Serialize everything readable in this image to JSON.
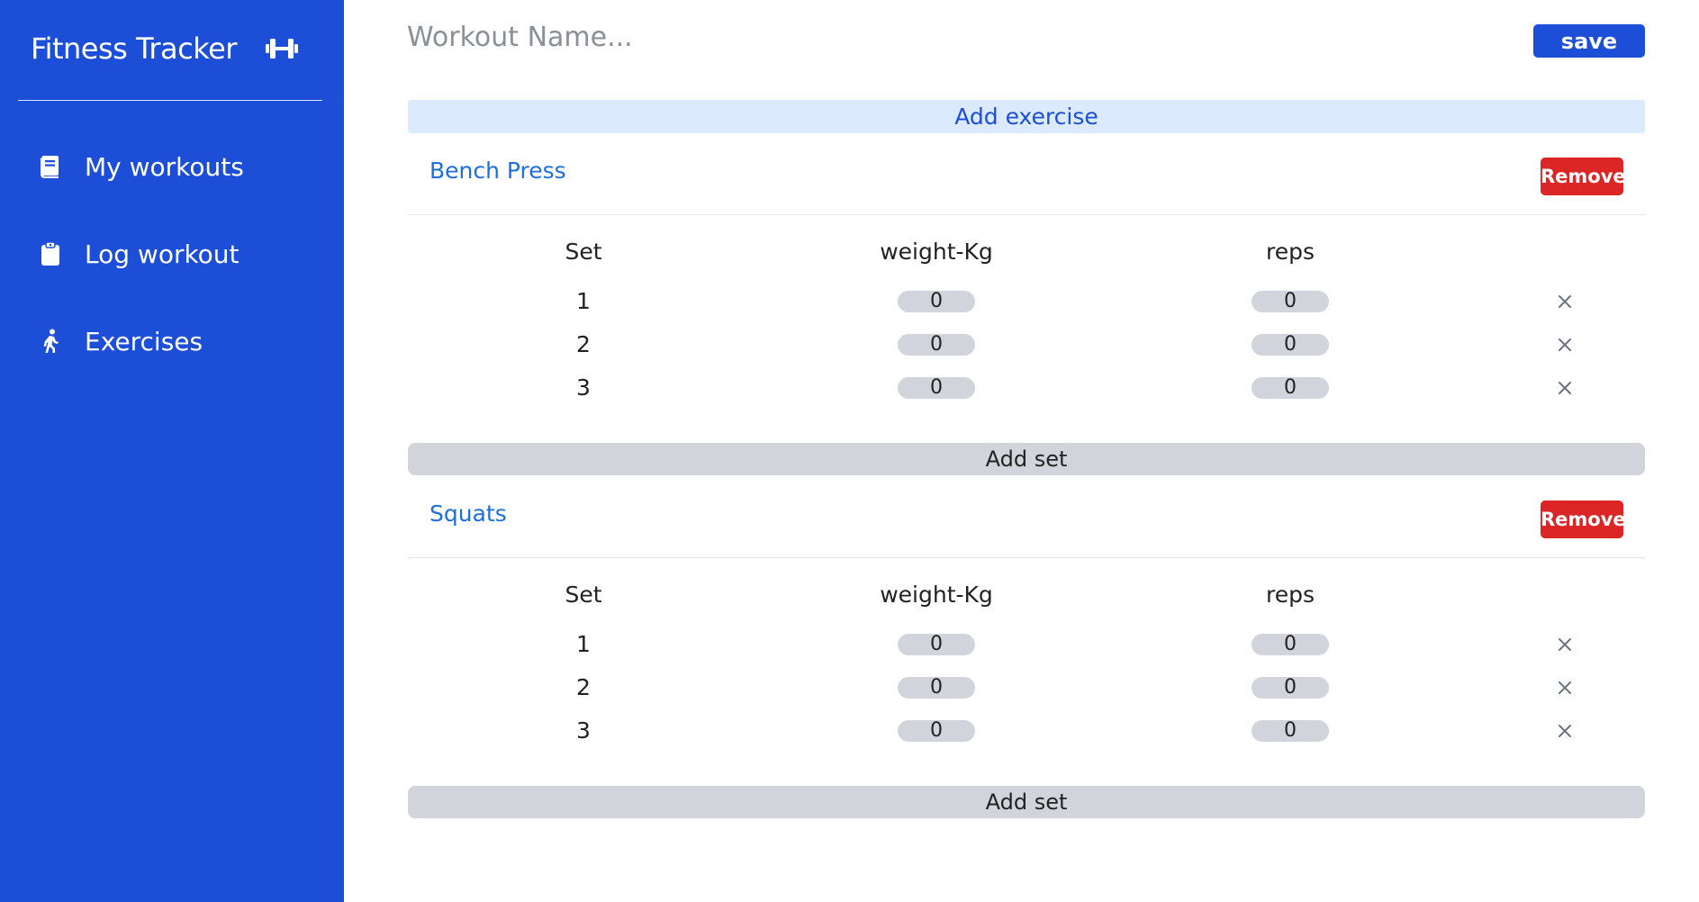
{
  "sidebar": {
    "brand_title": "Fitness Tracker",
    "brand_icon": "dumbbell-icon",
    "items": [
      {
        "label": "My workouts",
        "icon": "book-icon"
      },
      {
        "label": "Log workout",
        "icon": "clipboard-icon"
      },
      {
        "label": "Exercises",
        "icon": "walking-icon"
      }
    ],
    "accent": "#1d4ed8"
  },
  "header": {
    "workout_name_placeholder": "Workout Name...",
    "workout_name_value": "",
    "save_label": "save"
  },
  "add_exercise_label": "Add exercise",
  "exercises": [
    {
      "name": "Bench Press",
      "remove_label": "Remove",
      "columns": [
        "Set",
        "weight-Kg",
        "reps"
      ],
      "sets": [
        {
          "set": "1",
          "weight": "0",
          "reps": "0"
        },
        {
          "set": "2",
          "weight": "0",
          "reps": "0"
        },
        {
          "set": "3",
          "weight": "0",
          "reps": "0"
        }
      ],
      "add_set_label": "Add set"
    },
    {
      "name": "Squats",
      "remove_label": "Remove",
      "columns": [
        "Set",
        "weight-Kg",
        "reps"
      ],
      "sets": [
        {
          "set": "1",
          "weight": "0",
          "reps": "0"
        },
        {
          "set": "2",
          "weight": "0",
          "reps": "0"
        },
        {
          "set": "3",
          "weight": "0",
          "reps": "0"
        }
      ],
      "add_set_label": "Add set"
    }
  ],
  "colors": {
    "sidebar_bg": "#1d4ed8",
    "primary": "#1d4ed8",
    "danger": "#dc2626",
    "muted_bg": "#d1d5db",
    "light_blue": "#dbeafe"
  }
}
